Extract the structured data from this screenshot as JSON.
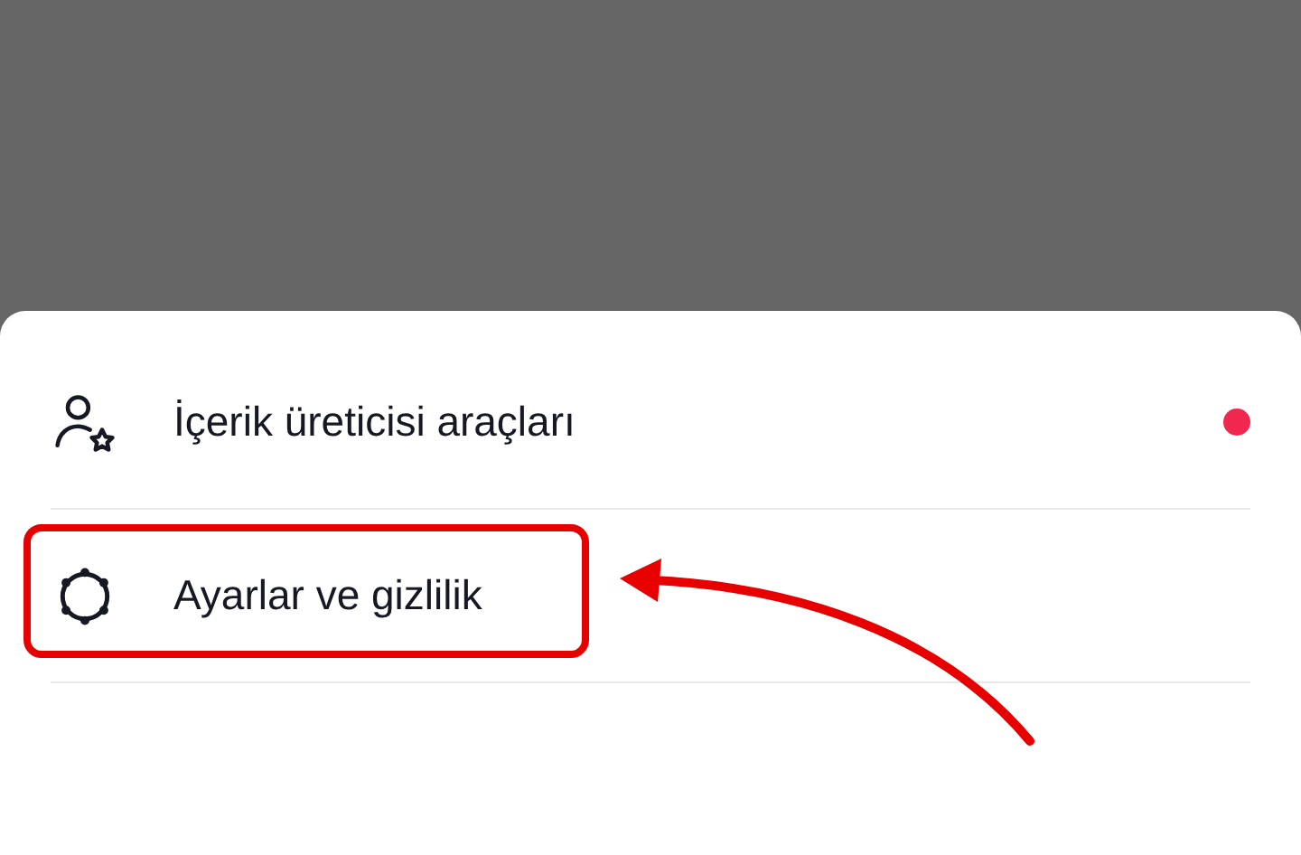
{
  "menu": {
    "items": [
      {
        "kind": "creator-tools",
        "label": "İçerik üreticisi araçları",
        "notification": true,
        "highlighted": false
      },
      {
        "kind": "settings",
        "label": "Ayarlar ve gizlilik",
        "notification": false,
        "highlighted": true
      }
    ]
  },
  "annotation": {
    "kind": "arrow"
  }
}
